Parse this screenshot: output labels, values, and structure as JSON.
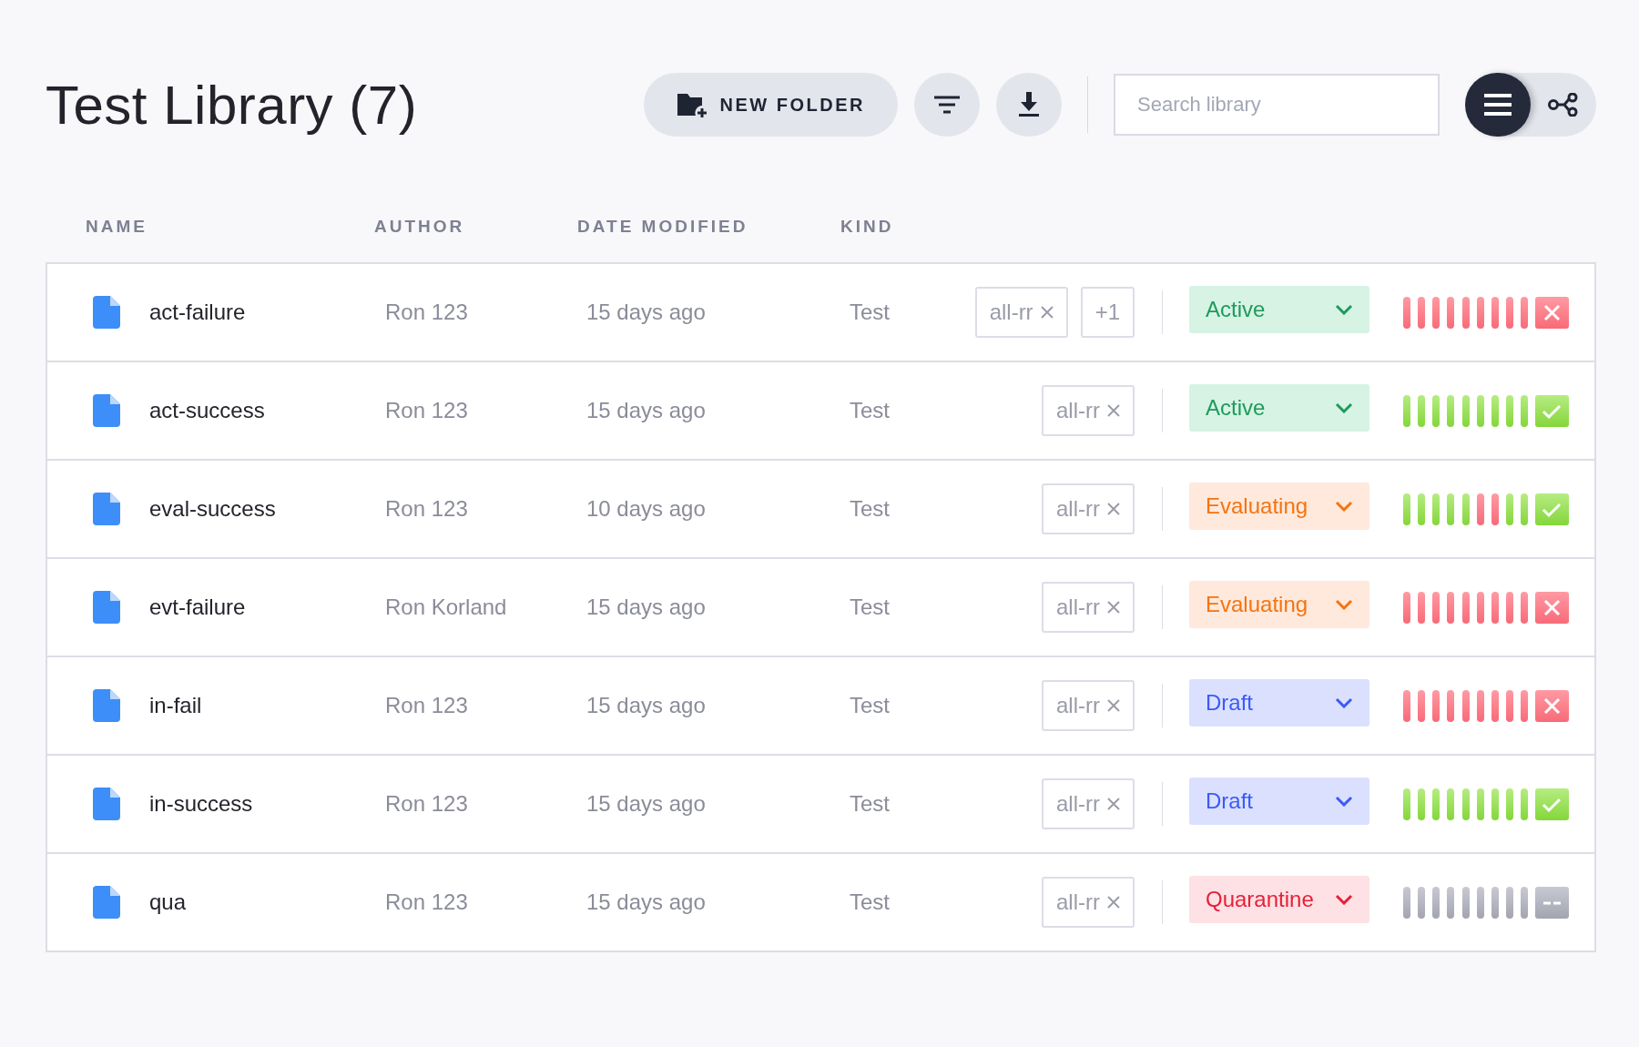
{
  "title": "Test Library (7)",
  "toolbar": {
    "new_folder": "NEW FOLDER",
    "search": {
      "placeholder": "Search library"
    },
    "view_toggle": [
      {
        "kind": "list",
        "selected": true
      },
      {
        "kind": "graph",
        "selected": false
      }
    ]
  },
  "table": {
    "columns": [
      "NAME",
      "AUTHOR",
      "DATE MODIFIED",
      "KIND"
    ],
    "rows": [
      {
        "name": "act-failure",
        "author": "Ron 123",
        "date": "15 days ago",
        "kind": "Test",
        "tags": [
          "all-rr"
        ],
        "more_tags": "+1",
        "status": {
          "label": "Active",
          "kind": "active"
        },
        "runs": [
          {
            "kind": "fail"
          },
          {
            "kind": "fail"
          },
          {
            "kind": "fail"
          },
          {
            "kind": "fail"
          },
          {
            "kind": "fail"
          },
          {
            "kind": "fail"
          },
          {
            "kind": "fail"
          },
          {
            "kind": "fail"
          },
          {
            "kind": "fail"
          }
        ],
        "result": {
          "kind": "fail"
        }
      },
      {
        "name": "act-success",
        "author": "Ron 123",
        "date": "15 days ago",
        "kind": "Test",
        "tags": [
          "all-rr"
        ],
        "status": {
          "label": "Active",
          "kind": "active"
        },
        "runs": [
          {
            "kind": "pass"
          },
          {
            "kind": "pass"
          },
          {
            "kind": "pass"
          },
          {
            "kind": "pass"
          },
          {
            "kind": "pass"
          },
          {
            "kind": "pass"
          },
          {
            "kind": "pass"
          },
          {
            "kind": "pass"
          },
          {
            "kind": "pass"
          }
        ],
        "result": {
          "kind": "pass"
        }
      },
      {
        "name": "eval-success",
        "author": "Ron 123",
        "date": "10 days ago",
        "kind": "Test",
        "tags": [
          "all-rr"
        ],
        "status": {
          "label": "Evaluating",
          "kind": "evaluating"
        },
        "runs": [
          {
            "kind": "pass"
          },
          {
            "kind": "pass"
          },
          {
            "kind": "pass"
          },
          {
            "kind": "pass"
          },
          {
            "kind": "pass"
          },
          {
            "kind": "fail"
          },
          {
            "kind": "fail"
          },
          {
            "kind": "pass"
          },
          {
            "kind": "pass"
          }
        ],
        "result": {
          "kind": "pass"
        }
      },
      {
        "name": "evt-failure",
        "author": "Ron Korland",
        "date": "15 days ago",
        "kind": "Test",
        "tags": [
          "all-rr"
        ],
        "status": {
          "label": "Evaluating",
          "kind": "evaluating"
        },
        "runs": [
          {
            "kind": "fail"
          },
          {
            "kind": "fail"
          },
          {
            "kind": "fail"
          },
          {
            "kind": "fail"
          },
          {
            "kind": "fail"
          },
          {
            "kind": "fail"
          },
          {
            "kind": "fail"
          },
          {
            "kind": "fail"
          },
          {
            "kind": "fail"
          }
        ],
        "result": {
          "kind": "fail"
        }
      },
      {
        "name": "in-fail",
        "author": "Ron 123",
        "date": "15 days ago",
        "kind": "Test",
        "tags": [
          "all-rr"
        ],
        "status": {
          "label": "Draft",
          "kind": "draft"
        },
        "runs": [
          {
            "kind": "fail"
          },
          {
            "kind": "fail"
          },
          {
            "kind": "fail"
          },
          {
            "kind": "fail"
          },
          {
            "kind": "fail"
          },
          {
            "kind": "fail"
          },
          {
            "kind": "fail"
          },
          {
            "kind": "fail"
          },
          {
            "kind": "fail"
          }
        ],
        "result": {
          "kind": "fail"
        }
      },
      {
        "name": "in-success",
        "author": "Ron 123",
        "date": "15 days ago",
        "kind": "Test",
        "tags": [
          "all-rr"
        ],
        "status": {
          "label": "Draft",
          "kind": "draft"
        },
        "runs": [
          {
            "kind": "pass"
          },
          {
            "kind": "pass"
          },
          {
            "kind": "pass"
          },
          {
            "kind": "pass"
          },
          {
            "kind": "pass"
          },
          {
            "kind": "pass"
          },
          {
            "kind": "pass"
          },
          {
            "kind": "pass"
          },
          {
            "kind": "pass"
          }
        ],
        "result": {
          "kind": "pass"
        }
      },
      {
        "name": "qua",
        "author": "Ron 123",
        "date": "15 days ago",
        "kind": "Test",
        "tags": [
          "all-rr"
        ],
        "status": {
          "label": "Quarantine",
          "kind": "quarantine"
        },
        "runs": [
          {
            "kind": "none"
          },
          {
            "kind": "none"
          },
          {
            "kind": "none"
          },
          {
            "kind": "none"
          },
          {
            "kind": "none"
          },
          {
            "kind": "none"
          },
          {
            "kind": "none"
          },
          {
            "kind": "none"
          },
          {
            "kind": "none"
          }
        ],
        "result": {
          "kind": "none"
        }
      }
    ]
  }
}
